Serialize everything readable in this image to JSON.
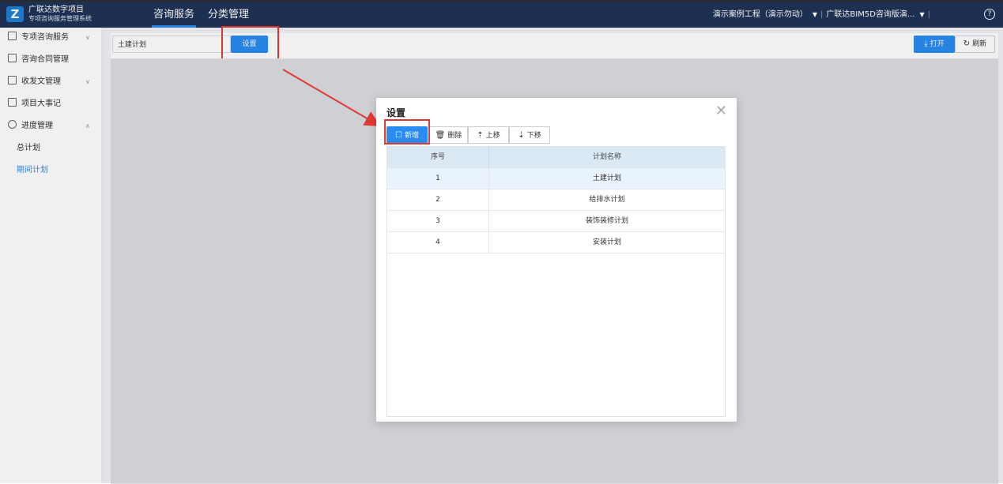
{
  "brand": {
    "line1": "广联达数字项目",
    "line2": "专项咨询服务管理系统",
    "logo": "Z"
  },
  "nav": [
    {
      "label": "咨询服务",
      "active": true
    },
    {
      "label": "分类管理",
      "active": false
    }
  ],
  "header": {
    "project": "演示案例工程（演示勿动）",
    "org": "广联达BIM5D咨询版演...",
    "sep": "|",
    "caret": "▼",
    "help": "?"
  },
  "sidebar": {
    "items": [
      {
        "label": "专项咨询服务",
        "icon": "document-icon",
        "chevron": "∨"
      },
      {
        "label": "咨询合同管理",
        "icon": "contract-icon"
      },
      {
        "label": "收发文管理",
        "icon": "mail-icon",
        "chevron": "∨"
      },
      {
        "label": "项目大事记",
        "icon": "list-icon"
      },
      {
        "label": "进度管理",
        "icon": "clock-icon",
        "chevron": "∧"
      }
    ],
    "subitems": [
      {
        "label": "总计划",
        "active": false
      },
      {
        "label": "期间计划",
        "active": true
      }
    ]
  },
  "toolbar": {
    "select_value": "土建计划",
    "settings_label": "设置",
    "open_label": "打开",
    "refresh_label": "刷新",
    "select_caret": "▼"
  },
  "modal": {
    "title": "设置",
    "close": "✕",
    "buttons": {
      "add": "新增",
      "delete": "删除",
      "up": "上移",
      "down": "下移"
    },
    "columns": [
      "序号",
      "计划名称"
    ],
    "rows": [
      {
        "no": "1",
        "name": "土建计划",
        "selected": true
      },
      {
        "no": "2",
        "name": "给排水计划",
        "selected": false
      },
      {
        "no": "3",
        "name": "装饰装修计划",
        "selected": false
      },
      {
        "no": "4",
        "name": "安装计划",
        "selected": false
      }
    ]
  },
  "colors": {
    "topbar": "#1f3357",
    "accent": "#2a8cf0",
    "highlight": "#e53935"
  }
}
